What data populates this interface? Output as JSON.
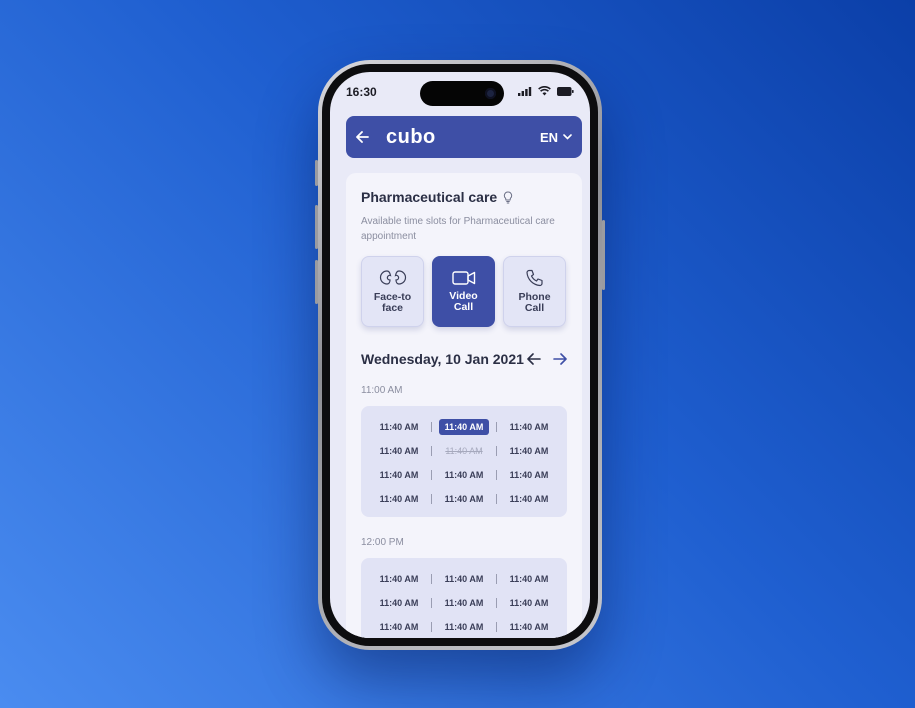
{
  "status": {
    "time": "16:30"
  },
  "header": {
    "logo": "cubo",
    "language": "EN"
  },
  "page": {
    "title": "Pharmaceutical care",
    "subtitle": "Available time slots for Pharmaceutical care appointment"
  },
  "appointment_types": [
    {
      "label_line1": "Face-to",
      "label_line2": "face",
      "icon": "face-to-face-icon",
      "active": false
    },
    {
      "label_line1": "Video",
      "label_line2": "Call",
      "icon": "video-camera-icon",
      "active": true
    },
    {
      "label_line1": "Phone",
      "label_line2": "Call",
      "icon": "phone-icon",
      "active": false
    }
  ],
  "date": "Wednesday, 10 Jan 2021",
  "groups": [
    {
      "heading": "11:00 AM",
      "rows": [
        [
          {
            "t": "11:40 AM",
            "state": "normal"
          },
          {
            "t": "11:40 AM",
            "state": "selected"
          },
          {
            "t": "11:40 AM",
            "state": "normal"
          }
        ],
        [
          {
            "t": "11:40 AM",
            "state": "normal"
          },
          {
            "t": "11:40 AM",
            "state": "disabled"
          },
          {
            "t": "11:40 AM",
            "state": "normal"
          }
        ],
        [
          {
            "t": "11:40 AM",
            "state": "normal"
          },
          {
            "t": "11:40 AM",
            "state": "normal"
          },
          {
            "t": "11:40 AM",
            "state": "normal"
          }
        ],
        [
          {
            "t": "11:40 AM",
            "state": "normal"
          },
          {
            "t": "11:40 AM",
            "state": "normal"
          },
          {
            "t": "11:40 AM",
            "state": "normal"
          }
        ]
      ]
    },
    {
      "heading": "12:00 PM",
      "rows": [
        [
          {
            "t": "11:40 AM",
            "state": "normal"
          },
          {
            "t": "11:40 AM",
            "state": "normal"
          },
          {
            "t": "11:40 AM",
            "state": "normal"
          }
        ],
        [
          {
            "t": "11:40 AM",
            "state": "normal"
          },
          {
            "t": "11:40 AM",
            "state": "normal"
          },
          {
            "t": "11:40 AM",
            "state": "normal"
          }
        ],
        [
          {
            "t": "11:40 AM",
            "state": "normal"
          },
          {
            "t": "11:40 AM",
            "state": "normal"
          },
          {
            "t": "11:40 AM",
            "state": "normal"
          }
        ]
      ]
    }
  ],
  "colors": {
    "accent": "#3e4fa6",
    "background": "#1f5fd0"
  }
}
